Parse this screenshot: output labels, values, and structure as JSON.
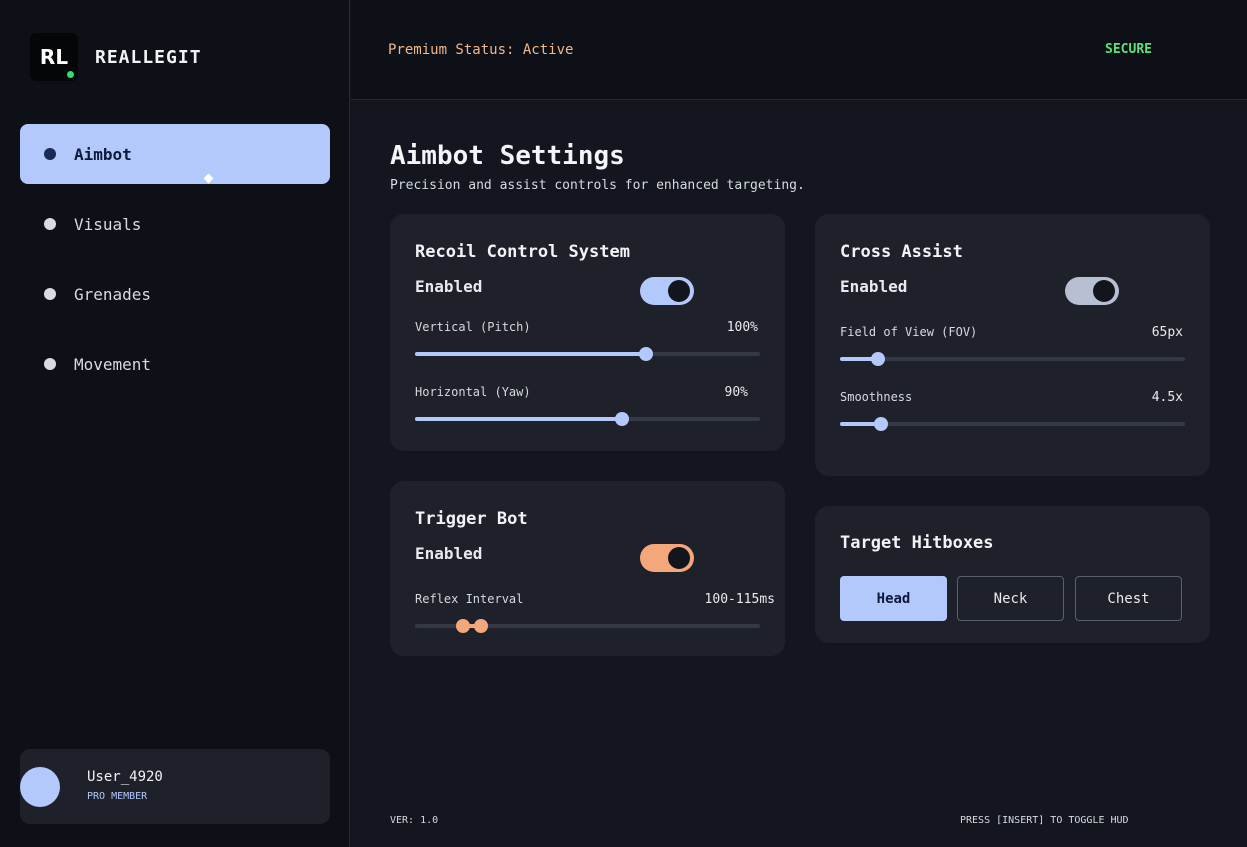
{
  "colors": {
    "accent_blue": "#b3c8fb",
    "accent_orange": "#f5a77c",
    "toggle_gray": "#b7c0d3",
    "secure_green": "#5fe07c",
    "status_orange": "#f0b88a"
  },
  "brand": {
    "logo_text": "RL",
    "name": "REALLEGIT"
  },
  "sidebar": {
    "items": [
      {
        "label": "Aimbot",
        "active": true
      },
      {
        "label": "Visuals",
        "active": false
      },
      {
        "label": "Grenades",
        "active": false
      },
      {
        "label": "Movement",
        "active": false
      }
    ]
  },
  "user": {
    "name": "User_4920",
    "role": "PRO MEMBER"
  },
  "header": {
    "status": "Premium Status: Active",
    "secure": "SECURE"
  },
  "page": {
    "title": "Aimbot Settings",
    "subtitle": "Precision and assist controls for enhanced targeting."
  },
  "recoil": {
    "title": "Recoil Control System",
    "enabled_label": "Enabled",
    "enabled": true,
    "vertical": {
      "label": "Vertical (Pitch)",
      "value": "100%",
      "level": 0.67
    },
    "horizontal": {
      "label": "Horizontal (Yaw)",
      "value": "90%",
      "level": 0.6
    }
  },
  "cross_assist": {
    "title": "Cross Assist",
    "enabled_label": "Enabled",
    "enabled": true,
    "fov": {
      "label": "Field of View (FOV)",
      "value": "65px",
      "level": 0.11
    },
    "smoothness": {
      "label": "Smoothness",
      "value": "4.5x",
      "level": 0.12
    }
  },
  "trigger": {
    "title": "Trigger Bot",
    "enabled_label": "Enabled",
    "enabled": true,
    "reflex": {
      "label": "Reflex Interval",
      "value": "100-115ms",
      "low": 0.14,
      "high": 0.19
    }
  },
  "hitboxes": {
    "title": "Target Hitboxes",
    "options": [
      {
        "label": "Head",
        "active": true
      },
      {
        "label": "Neck",
        "active": false
      },
      {
        "label": "Chest",
        "active": false
      }
    ]
  },
  "footer": {
    "version": "VER: 1.0",
    "hint": "PRESS [INSERT] TO TOGGLE HUD"
  }
}
